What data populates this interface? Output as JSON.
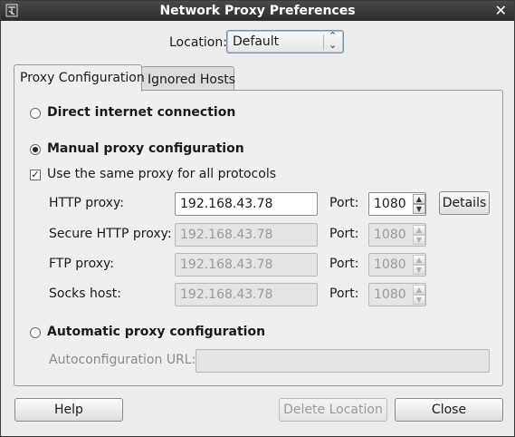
{
  "window": {
    "title": "Network Proxy Preferences"
  },
  "location": {
    "label": "Location:",
    "value": "Default"
  },
  "tabs": [
    {
      "label": "Proxy Configuration",
      "active": true
    },
    {
      "label": "Ignored Hosts",
      "active": false
    }
  ],
  "direct": {
    "label": "Direct internet connection",
    "selected": false
  },
  "manual": {
    "label": "Manual proxy configuration",
    "selected": true,
    "same_proxy_label": "Use the same proxy for all protocols",
    "same_proxy_checked": true,
    "port_label": "Port:",
    "details_label": "Details",
    "rows": [
      {
        "label": "HTTP proxy:",
        "host": "192.168.43.78",
        "port": "1080",
        "enabled": true
      },
      {
        "label": "Secure HTTP proxy:",
        "host": "192.168.43.78",
        "port": "1080",
        "enabled": false
      },
      {
        "label": "FTP proxy:",
        "host": "192.168.43.78",
        "port": "1080",
        "enabled": false
      },
      {
        "label": "Socks host:",
        "host": "192.168.43.78",
        "port": "1080",
        "enabled": false
      }
    ]
  },
  "automatic": {
    "label": "Automatic proxy configuration",
    "selected": false,
    "url_label": "Autoconfiguration URL:",
    "url_value": ""
  },
  "buttons": {
    "help": "Help",
    "delete_location": "Delete Location",
    "close": "Close"
  }
}
